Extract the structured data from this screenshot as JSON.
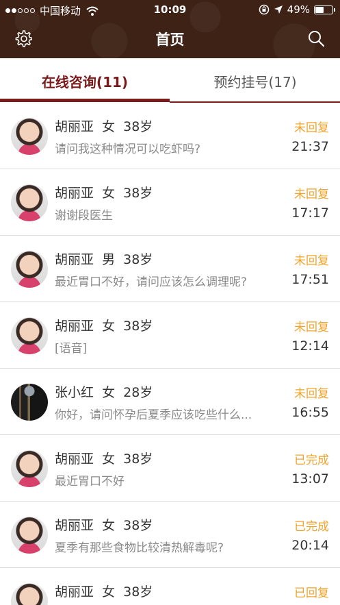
{
  "status_bar": {
    "carrier": "中国移动",
    "time": "10:09",
    "battery": "49%",
    "battery_level": 0.49,
    "signal_strength": 2,
    "signal_total": 5
  },
  "nav": {
    "title": "首页",
    "left_icon": "gear-icon",
    "right_icon": "search-icon"
  },
  "tabs": [
    {
      "label": "在线咨询(11)",
      "active": true
    },
    {
      "label": "预约挂号(17)",
      "active": false
    }
  ],
  "colors": {
    "header_bg": "#3e2216",
    "accent": "#7a1a1a",
    "pending_status": "#f0a32a"
  },
  "messages": [
    {
      "name": "胡丽亚  女  38岁",
      "message": "请问我这种情况可以吃虾吗?",
      "status": "未回复",
      "time": "21:37",
      "avatar": "child"
    },
    {
      "name": "胡丽亚  女  38岁",
      "message": "谢谢段医生",
      "status": "未回复",
      "time": "17:17",
      "avatar": "child"
    },
    {
      "name": "胡丽亚  男  38岁",
      "message": "最近胃口不好，请问应该怎么调理呢?",
      "status": "未回复",
      "time": "17:51",
      "avatar": "child"
    },
    {
      "name": "胡丽亚  女  38岁",
      "message": "[语音]",
      "status": "未回复",
      "time": "12:14",
      "avatar": "child"
    },
    {
      "name": "张小红  女  28岁",
      "message": "你好，请问怀孕后夏季应该吃些什么...",
      "status": "未回复",
      "time": "16:55",
      "avatar": "dark"
    },
    {
      "name": "胡丽亚  女  38岁",
      "message": "最近胃口不好",
      "status": "已完成",
      "time": "13:07",
      "avatar": "child"
    },
    {
      "name": "胡丽亚  女  38岁",
      "message": "夏季有那些食物比较清热解毒呢?",
      "status": "已完成",
      "time": "20:14",
      "avatar": "child"
    },
    {
      "name": "胡丽亚  女  38岁",
      "message": "",
      "status": "已回复",
      "time": "",
      "avatar": "child"
    }
  ]
}
